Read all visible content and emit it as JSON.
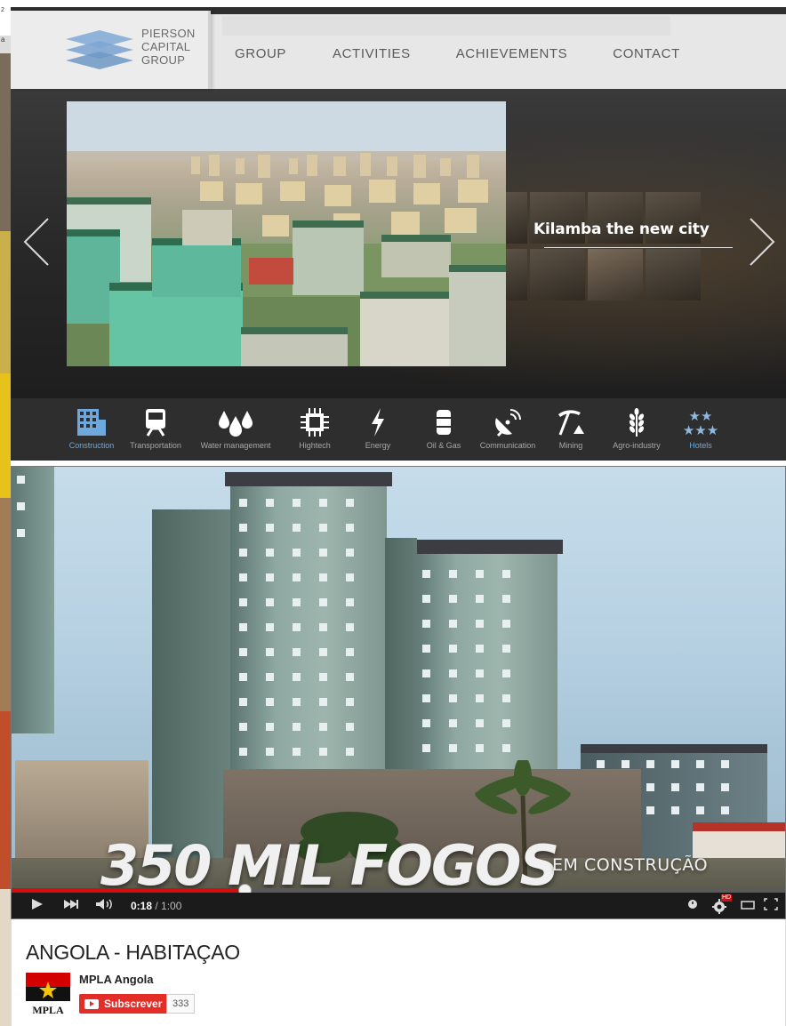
{
  "left_edge": {
    "frag1": "2",
    "frag2": "a"
  },
  "site": {
    "logo": {
      "line1": "PIERSON",
      "line2": "CAPITAL",
      "line3": "GROUP"
    },
    "nav": [
      "GROUP",
      "ACTIVITIES",
      "ACHIEVEMENTS",
      "CONTACT"
    ],
    "slider": {
      "caption": "Kilamba the new city"
    },
    "categories": [
      {
        "label": "Construction",
        "icon": "building-icon",
        "active": true
      },
      {
        "label": "Transportation",
        "icon": "train-icon",
        "active": false
      },
      {
        "label": "Water management",
        "icon": "water-drops-icon",
        "active": false
      },
      {
        "label": "Hightech",
        "icon": "chip-icon",
        "active": false
      },
      {
        "label": "Energy",
        "icon": "lightning-icon",
        "active": false
      },
      {
        "label": "Oil & Gas",
        "icon": "barrel-icon",
        "active": false
      },
      {
        "label": "Communication",
        "icon": "satellite-dish-icon",
        "active": false
      },
      {
        "label": "Mining",
        "icon": "pickaxe-icon",
        "active": false
      },
      {
        "label": "Agro-industry",
        "icon": "wheat-icon",
        "active": false
      },
      {
        "label": "Hotels",
        "icon": "stars-icon",
        "active": true
      }
    ]
  },
  "video": {
    "overlay_big": "350 MIL FOGOS",
    "overlay_small": "EM CONSTRUÇÃO",
    "progress": 0.3,
    "current_time": "0:18",
    "duration": "1:00",
    "hd_badge": "HD"
  },
  "info": {
    "title": "ANGOLA - HABITAÇAO",
    "channel": "MPLA Angola",
    "flag_text": "MPLA",
    "subscribe_label": "Subscrever",
    "subscriber_count": "333"
  },
  "colors": {
    "accent": "#6fa8dc",
    "youtube_red": "#e52d27",
    "progress_red": "#d20f0f"
  }
}
